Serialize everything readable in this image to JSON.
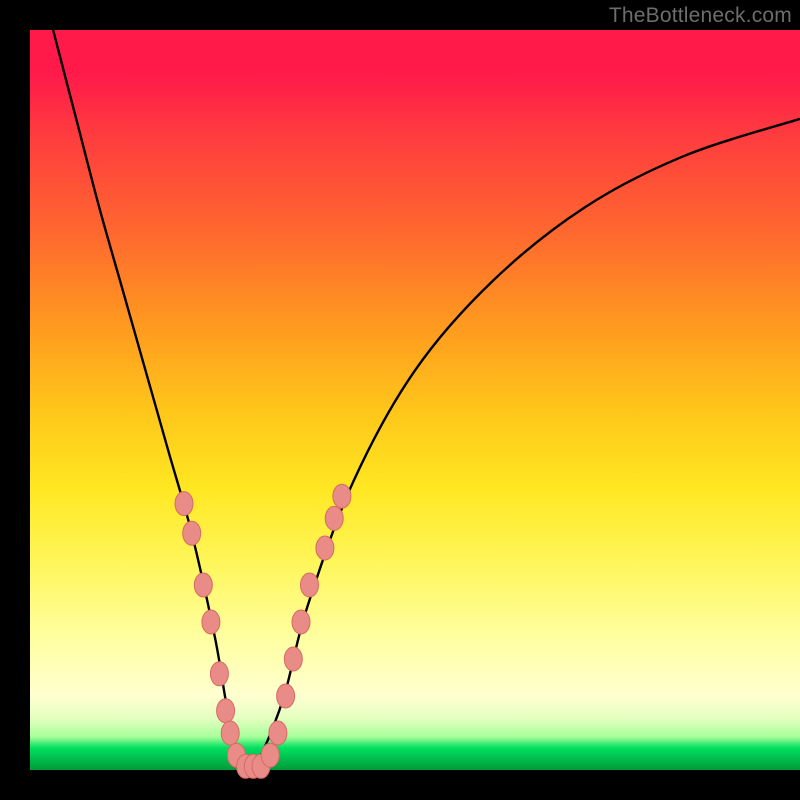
{
  "watermark": "TheBottleneck.com",
  "colors": {
    "background": "#000000",
    "curve_stroke": "#000000",
    "marker_fill": "#e98b87",
    "marker_stroke": "#d86a64",
    "watermark": "#6d6d6d"
  },
  "chart_data": {
    "type": "line",
    "title": "",
    "xlabel": "",
    "ylabel": "",
    "xlim": [
      0,
      100
    ],
    "ylim": [
      0,
      100
    ],
    "series": [
      {
        "name": "bottleneck-curve",
        "x": [
          3,
          6,
          9,
          12,
          15,
          18,
          21,
          24,
          25.5,
          27,
          28.5,
          30,
          33,
          36,
          42,
          50,
          60,
          72,
          85,
          100
        ],
        "y": [
          100,
          88,
          76,
          65,
          54,
          43,
          32,
          18,
          9,
          2,
          0,
          2,
          10,
          22,
          39,
          54,
          66,
          76,
          83,
          88
        ]
      }
    ],
    "markers": {
      "note": "salmon oval markers clustered near the trough of the V",
      "points": [
        {
          "x": 20.0,
          "y": 36
        },
        {
          "x": 21.0,
          "y": 32
        },
        {
          "x": 22.5,
          "y": 25
        },
        {
          "x": 23.5,
          "y": 20
        },
        {
          "x": 24.6,
          "y": 13
        },
        {
          "x": 25.4,
          "y": 8
        },
        {
          "x": 26.0,
          "y": 5
        },
        {
          "x": 26.8,
          "y": 2
        },
        {
          "x": 28.0,
          "y": 0.5
        },
        {
          "x": 29.0,
          "y": 0.5
        },
        {
          "x": 30.0,
          "y": 0.5
        },
        {
          "x": 31.2,
          "y": 2
        },
        {
          "x": 32.2,
          "y": 5
        },
        {
          "x": 33.2,
          "y": 10
        },
        {
          "x": 34.2,
          "y": 15
        },
        {
          "x": 35.2,
          "y": 20
        },
        {
          "x": 36.3,
          "y": 25
        },
        {
          "x": 38.3,
          "y": 30
        },
        {
          "x": 39.5,
          "y": 34
        },
        {
          "x": 40.5,
          "y": 37
        }
      ]
    }
  }
}
